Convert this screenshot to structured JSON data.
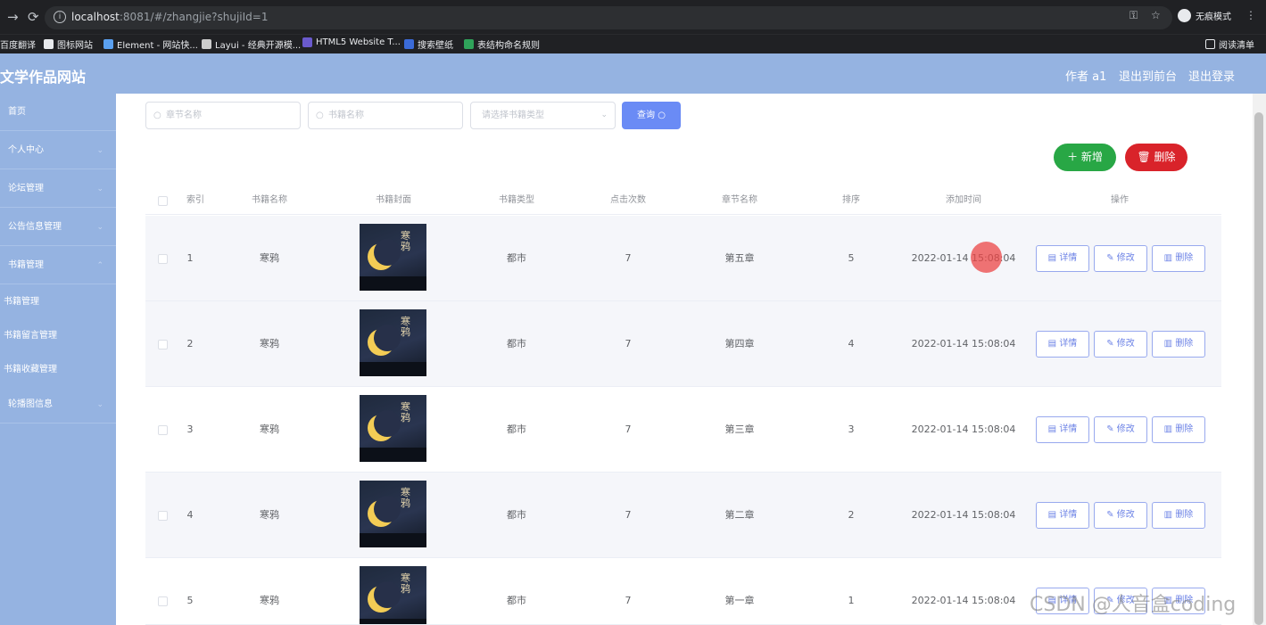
{
  "browser": {
    "url_host": "localhost",
    "url_rest": ":8081/#/zhangjie?shujiId=1",
    "incognito_label": "无痕模式",
    "bookmarks": [
      "百度翻译",
      "图标网站",
      "Element - 网站快...",
      "Layui - 经典开源模...",
      "HTML5 Website T...",
      "搜索壁纸",
      "表结构命名规则"
    ],
    "reading_list": "阅读清单"
  },
  "header": {
    "title": "文学作品网站",
    "author": "作者 a1",
    "back_to_backend": "退出到前台",
    "logout": "退出登录"
  },
  "sidebar": {
    "items": [
      {
        "label": "首页"
      },
      {
        "label": "个人中心"
      },
      {
        "label": "论坛管理"
      },
      {
        "label": "公告信息管理"
      },
      {
        "label": "书籍管理"
      }
    ],
    "subitems": [
      {
        "label": "书籍管理"
      },
      {
        "label": "书籍留言管理"
      },
      {
        "label": "书籍收藏管理"
      }
    ],
    "last_item": {
      "label": "轮播图信息"
    }
  },
  "search": {
    "chapter_placeholder": "章节名称",
    "book_placeholder": "书籍名称",
    "type_placeholder": "请选择书籍类型",
    "query_label": "查询"
  },
  "actions": {
    "add_label": "新增",
    "delete_label": "删除"
  },
  "table": {
    "headers": [
      "索引",
      "书籍名称",
      "书籍封面",
      "书籍类型",
      "点击次数",
      "章节名称",
      "排序",
      "添加时间",
      "操作"
    ],
    "cover_title": "寒鸦",
    "rows": [
      {
        "index": "1",
        "name": "寒鸦",
        "type": "都市",
        "clicks": "7",
        "chapter": "第五章",
        "order": "5",
        "time": "2022-01-14 15:08:04"
      },
      {
        "index": "2",
        "name": "寒鸦",
        "type": "都市",
        "clicks": "7",
        "chapter": "第四章",
        "order": "4",
        "time": "2022-01-14 15:08:04"
      },
      {
        "index": "3",
        "name": "寒鸦",
        "type": "都市",
        "clicks": "7",
        "chapter": "第三章",
        "order": "3",
        "time": "2022-01-14 15:08:04"
      },
      {
        "index": "4",
        "name": "寒鸦",
        "type": "都市",
        "clicks": "7",
        "chapter": "第二章",
        "order": "2",
        "time": "2022-01-14 15:08:04"
      },
      {
        "index": "5",
        "name": "寒鸦",
        "type": "都市",
        "clicks": "7",
        "chapter": "第一章",
        "order": "1",
        "time": "2022-01-14 15:08:04"
      }
    ],
    "op_labels": {
      "detail": "详情",
      "edit": "修改",
      "delete": "删除"
    }
  },
  "watermark": "CSDN @人音盒coding",
  "colors": {
    "header_bg": "#95b3e1",
    "add_btn": "#28a745",
    "delete_btn": "#d9232a",
    "query_btn": "#6a8bf5"
  }
}
